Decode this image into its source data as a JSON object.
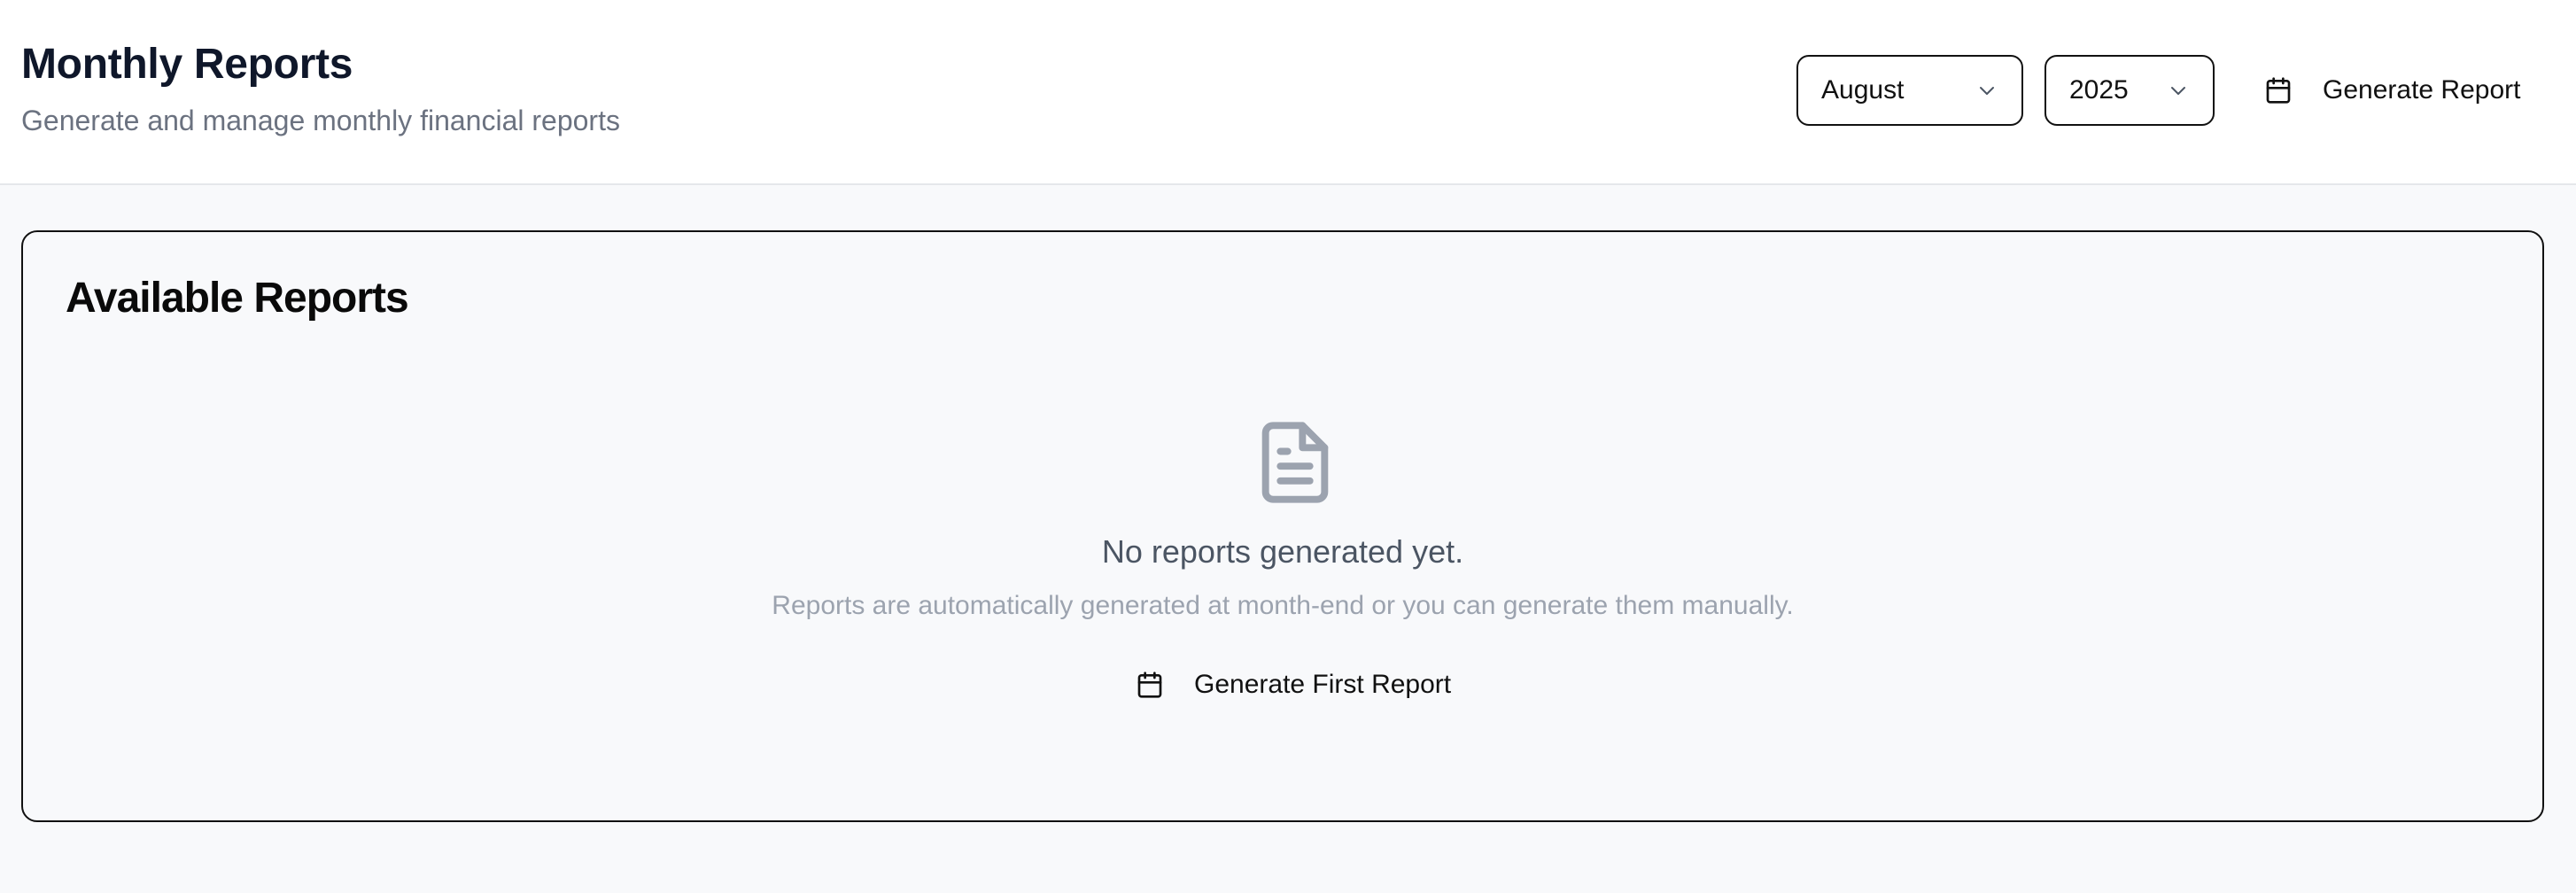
{
  "header": {
    "title": "Monthly Reports",
    "subtitle": "Generate and manage monthly financial reports",
    "month_select": {
      "value": "August",
      "icon": "chevron-down-icon"
    },
    "year_select": {
      "value": "2025",
      "icon": "chevron-down-icon"
    },
    "generate_button": {
      "label": "Generate Report",
      "icon": "calendar-icon"
    }
  },
  "reports_card": {
    "title": "Available Reports",
    "empty_state": {
      "icon": "document-icon",
      "title": "No reports generated yet.",
      "description": "Reports are automatically generated at month-end or you can generate them manually.",
      "button": {
        "label": "Generate First Report",
        "icon": "calendar-icon"
      }
    }
  },
  "colors": {
    "background": "#f8f9fb",
    "header_background": "#ffffff",
    "border": "#111111",
    "muted_text": "#6b7280",
    "icon_gray": "#9ca3af"
  }
}
